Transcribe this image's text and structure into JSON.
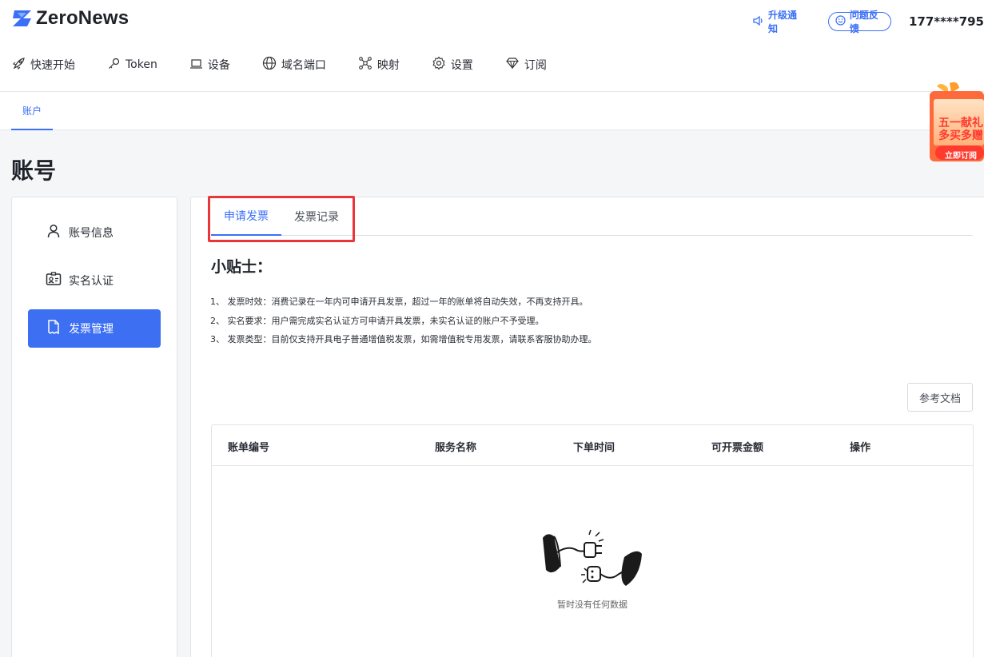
{
  "app": {
    "logo_text": "ZeroNews"
  },
  "header": {
    "notice_label": "升级通知",
    "feedback_label": "问题反馈",
    "user_phone": "177****795"
  },
  "nav": {
    "items": [
      {
        "label": "快速开始",
        "icon": "rocket-icon"
      },
      {
        "label": "Token",
        "icon": "key-icon"
      },
      {
        "label": "设备",
        "icon": "laptop-icon"
      },
      {
        "label": "域名端口",
        "icon": "globe-icon"
      },
      {
        "label": "映射",
        "icon": "network-icon"
      },
      {
        "label": "设置",
        "icon": "gear-icon"
      },
      {
        "label": "订阅",
        "icon": "diamond-icon"
      }
    ]
  },
  "subnav": {
    "active_tab": "账户"
  },
  "promo": {
    "line1": "五一献礼",
    "line2": "多买多赠",
    "button": "立即订阅"
  },
  "page": {
    "title": "账号"
  },
  "sidebar": {
    "items": [
      {
        "label": "账号信息",
        "icon": "user-icon"
      },
      {
        "label": "实名认证",
        "icon": "id-card-icon"
      },
      {
        "label": "发票管理",
        "icon": "invoice-icon",
        "active": true
      }
    ]
  },
  "invoice": {
    "tabs": [
      "申请发票",
      "发票记录"
    ],
    "tips_title": "小贴士：",
    "tips": [
      "1、 发票时效：消费记录在一年内可申请开具发票，超过一年的账单将自动失效，不再支持开具。",
      "2、 实名要求：用户需完成实名认证方可申请开具发票，未实名认证的账户不予受理。",
      "3、 发票类型：目前仅支持开具电子普通增值税发票，如需增值税专用发票，请联系客服协助办理。"
    ],
    "doc_button": "参考文档",
    "columns": [
      "账单编号",
      "服务名称",
      "下单时间",
      "可开票金额",
      "操作"
    ],
    "empty_text": "暂时没有任何数据"
  },
  "colors": {
    "accent": "#3b6ff5",
    "highlight": "#e8363a"
  }
}
